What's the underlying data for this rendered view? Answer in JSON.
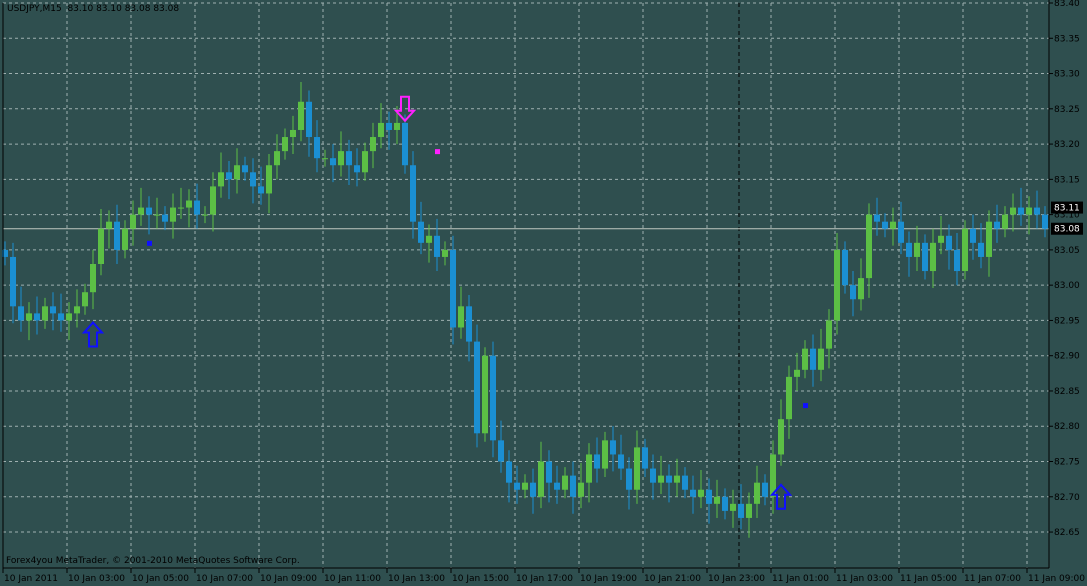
{
  "header": {
    "symbol": "USDJPY,M15",
    "quotes": "83.10 83.10 83.08 83.08"
  },
  "footer": {
    "copyright": "Forex4you MetaTrader, © 2001-2010 MetaQuotes Software Corp."
  },
  "colors": {
    "background": "#2f4f4f",
    "bull": "#5cbf45",
    "bear": "#1b8fd2",
    "grid": "#9fb0b0",
    "bid_line": "#c0c8c0",
    "buy_arrow": "#1010ff",
    "sell_arrow": "#ff20ff"
  },
  "chart_data": {
    "type": "candlestick",
    "title": "USDJPY,M15",
    "ylim": [
      82.62,
      83.4
    ],
    "y_ticks": [
      "83.40",
      "83.35",
      "83.30",
      "83.25",
      "83.20",
      "83.15",
      "83.10",
      "83.05",
      "83.00",
      "82.95",
      "82.90",
      "82.85",
      "82.80",
      "82.75",
      "82.70",
      "82.65"
    ],
    "x_ticks": [
      "10 Jan 2011",
      "10 Jan 03:00",
      "10 Jan 05:00",
      "10 Jan 07:00",
      "10 Jan 09:00",
      "10 Jan 11:00",
      "10 Jan 13:00",
      "10 Jan 15:00",
      "10 Jan 17:00",
      "10 Jan 19:00",
      "10 Jan 21:00",
      "10 Jan 23:00",
      "11 Jan 01:00",
      "11 Jan 03:00",
      "11 Jan 05:00",
      "11 Jan 07:00",
      "11 Jan 09:00"
    ],
    "first_open": 83.05,
    "close": [
      83.04,
      82.97,
      82.95,
      82.96,
      82.95,
      82.97,
      82.96,
      82.95,
      82.96,
      82.97,
      82.99,
      83.03,
      83.08,
      83.09,
      83.05,
      83.08,
      83.1,
      83.11,
      83.1,
      83.1,
      83.09,
      83.11,
      83.11,
      83.12,
      83.1,
      83.1,
      83.14,
      83.16,
      83.15,
      83.17,
      83.16,
      83.14,
      83.13,
      83.17,
      83.19,
      83.21,
      83.22,
      83.26,
      83.21,
      83.18,
      83.18,
      83.17,
      83.19,
      83.17,
      83.16,
      83.19,
      83.21,
      83.23,
      83.22,
      83.23,
      83.17,
      83.09,
      83.06,
      83.07,
      83.04,
      83.05,
      82.94,
      82.97,
      82.92,
      82.79,
      82.9,
      82.78,
      82.75,
      82.72,
      82.71,
      82.72,
      82.7,
      82.75,
      82.72,
      82.71,
      82.73,
      82.7,
      82.72,
      82.76,
      82.74,
      82.78,
      82.76,
      82.74,
      82.71,
      82.77,
      82.74,
      82.72,
      82.73,
      82.72,
      82.73,
      82.71,
      82.7,
      82.71,
      82.69,
      82.7,
      82.68,
      82.69,
      82.67,
      82.69,
      82.72,
      82.7,
      82.76,
      82.81,
      82.87,
      82.88,
      82.91,
      82.88,
      82.91,
      82.95,
      83.05,
      83.0,
      82.98,
      83.01,
      83.1,
      83.09,
      83.08,
      83.09,
      83.06,
      83.04,
      83.06,
      83.02,
      83.06,
      83.07,
      83.05,
      83.02,
      83.08,
      83.06,
      83.04,
      83.09,
      83.08,
      83.1,
      83.11,
      83.1,
      83.11,
      83.1,
      83.08
    ],
    "bid": "83.08",
    "ask": "83.11",
    "period_separator": "11 Jan 00:00",
    "signals": [
      {
        "type": "buy",
        "bar": 11,
        "price": 82.93
      },
      {
        "type": "sell",
        "bar": 50,
        "price": 83.25
      },
      {
        "type": "buy",
        "bar": 97,
        "price": 82.7
      }
    ],
    "markers": [
      {
        "color": "blue",
        "bar": 18,
        "price": 83.06
      },
      {
        "color": "magenta",
        "bar": 54,
        "price": 83.19
      },
      {
        "color": "blue",
        "bar": 100,
        "price": 82.83
      }
    ]
  }
}
